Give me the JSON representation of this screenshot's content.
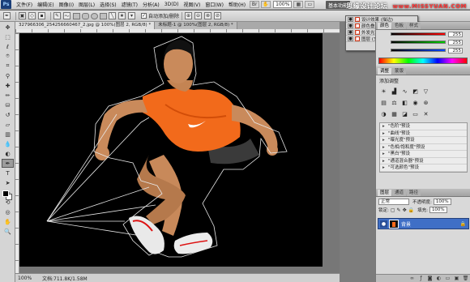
{
  "menubar": {
    "logo": "Ps",
    "items": [
      "文件(F)",
      "编辑(E)",
      "图像(I)",
      "图层(L)",
      "选择(S)",
      "滤镜(T)",
      "分析(A)",
      "3D(D)",
      "视图(V)",
      "窗口(W)",
      "帮助(H)"
    ],
    "zoom": "100%",
    "workspace": "基本功能"
  },
  "watermark": {
    "site": "思缘设计论坛",
    "url": "www.MISSYUAN.COM"
  },
  "options": {
    "auto_add_delete_label": "自动添加/删除"
  },
  "document": {
    "tabs": [
      "327966306_254256660467_2.jpg @ 100%(图层 2, RGB/8) *",
      "未标题-1 @ 100%(图层 2, RGB/8) *"
    ],
    "status_zoom": "100%",
    "status_doc": "文档:711.8K/1.58M"
  },
  "style_popup": {
    "rows": [
      "设计效果 (描边)",
      "颜色叠加 - 50 像素",
      "外发光 - 50 像素",
      "图层 (文字)"
    ]
  },
  "color_panel": {
    "tabs": [
      "颜色",
      "色板",
      "样式"
    ],
    "sliders": [
      {
        "name": "R",
        "value": "255",
        "color": "#ff0000"
      },
      {
        "name": "G",
        "value": "255",
        "color": "#00c000"
      },
      {
        "name": "B",
        "value": "255",
        "color": "#0040ff"
      }
    ]
  },
  "adjust_panel": {
    "tabs": [
      "调整",
      "蒙版"
    ],
    "title": "添加调整",
    "presets": [
      "\"色阶\"预设",
      "\"曲线\"预设",
      "\"曝光度\"预设",
      "\"色相/饱和度\"预设",
      "\"黑白\"预设",
      "\"通道混合器\"预设",
      "\"可选颜色\"预设"
    ]
  },
  "layers_panel": {
    "tabs": [
      "图层",
      "通道",
      "路径"
    ],
    "blend_mode": "正常",
    "opacity_label": "不透明度:",
    "opacity_value": "100%",
    "lock_label": "锁定:",
    "fill_label": "填充:",
    "fill_value": "100%",
    "layers": [
      {
        "name": "背景",
        "visible": true
      }
    ]
  }
}
